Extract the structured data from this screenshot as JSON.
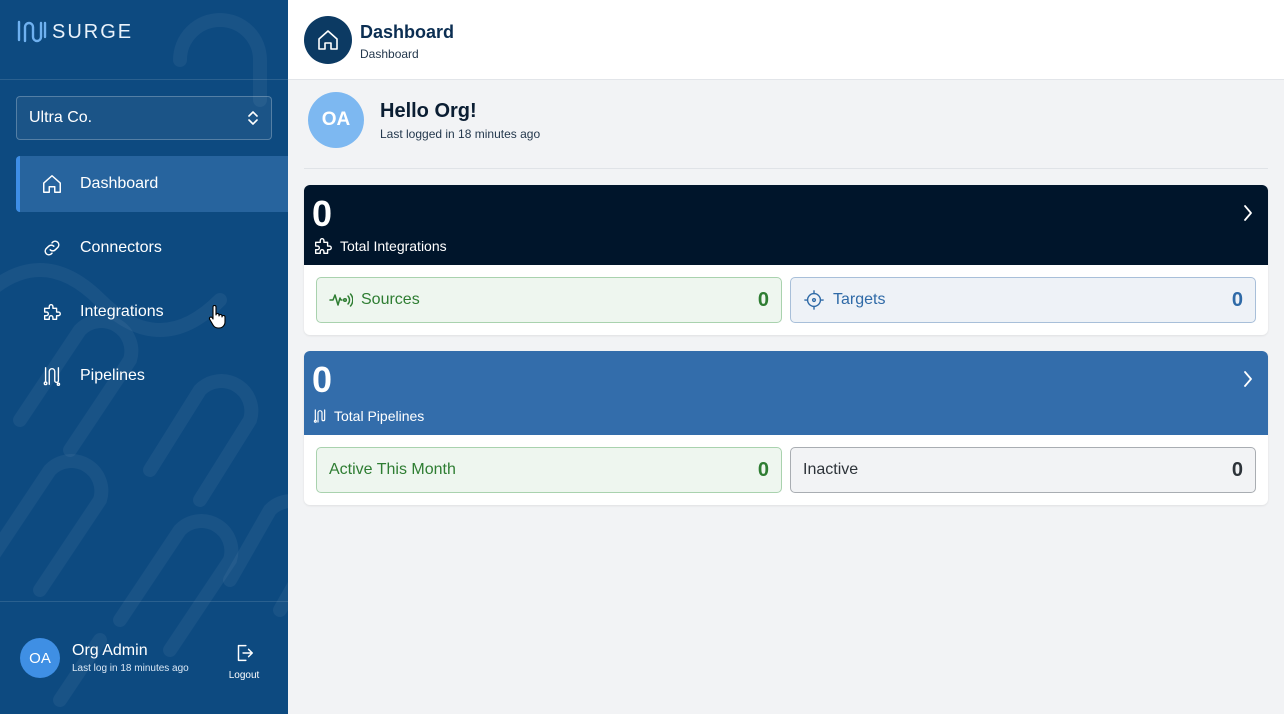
{
  "brand": {
    "name": "SURGE"
  },
  "org_select": {
    "value": "Ultra Co."
  },
  "nav": {
    "items": [
      {
        "label": "Dashboard",
        "icon": "home-icon",
        "active": true
      },
      {
        "label": "Connectors",
        "icon": "link-icon",
        "active": false
      },
      {
        "label": "Integrations",
        "icon": "puzzle-icon",
        "active": false
      },
      {
        "label": "Pipelines",
        "icon": "pipeline-icon",
        "active": false
      }
    ]
  },
  "user": {
    "initials": "OA",
    "name": "Org Admin",
    "last_login": "Last log in 18 minutes ago"
  },
  "logout": {
    "label": "Logout"
  },
  "header": {
    "title": "Dashboard",
    "breadcrumb": "Dashboard"
  },
  "greeting": {
    "initials": "OA",
    "title": "Hello Org!",
    "subtitle": "Last logged in 18 minutes ago"
  },
  "integrations_card": {
    "count": "0",
    "label": "Total Integrations",
    "color": "#00152b",
    "stats": [
      {
        "label": "Sources",
        "value": "0",
        "icon": "signal-icon"
      },
      {
        "label": "Targets",
        "value": "0",
        "icon": "crosshair-icon"
      }
    ]
  },
  "pipelines_card": {
    "count": "0",
    "label": "Total Pipelines",
    "color": "#336dab",
    "stats": [
      {
        "label": "Active This Month",
        "value": "0"
      },
      {
        "label": "Inactive",
        "value": "0"
      }
    ]
  },
  "colors": {
    "sidebar": "#0d4a80",
    "accent": "#3e8ee6",
    "success": "#2e7d32"
  }
}
